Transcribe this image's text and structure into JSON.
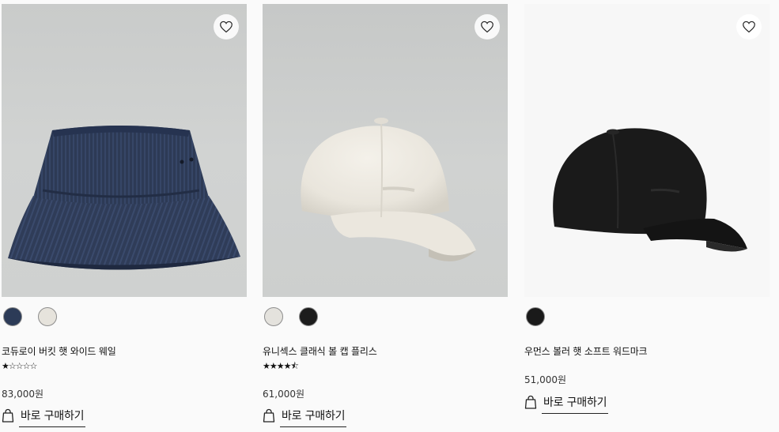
{
  "products": [
    {
      "name": "코듀로이 버킷 햇 와이드 웨일",
      "rating_stars": "★☆☆☆☆",
      "price": "83,000원",
      "buy_label": "바로 구매하기",
      "swatches": [
        "#2c3b57",
        "#e6e3dc"
      ]
    },
    {
      "name": "유니섹스 클래식 볼 캡 플리스",
      "rating_stars": "★★★★⯪",
      "price": "61,000원",
      "buy_label": "바로 구매하기",
      "swatches": [
        "#e4e2dd",
        "#1c1c1c"
      ]
    },
    {
      "name": "우먼스 볼러 햇 소프트 워드마크",
      "price": "51,000원",
      "buy_label": "바로 구매하기",
      "swatches": [
        "#1a1a1a"
      ]
    }
  ],
  "icons": {
    "wishlist": "heart-icon",
    "buy": "shopping-bag-icon"
  }
}
